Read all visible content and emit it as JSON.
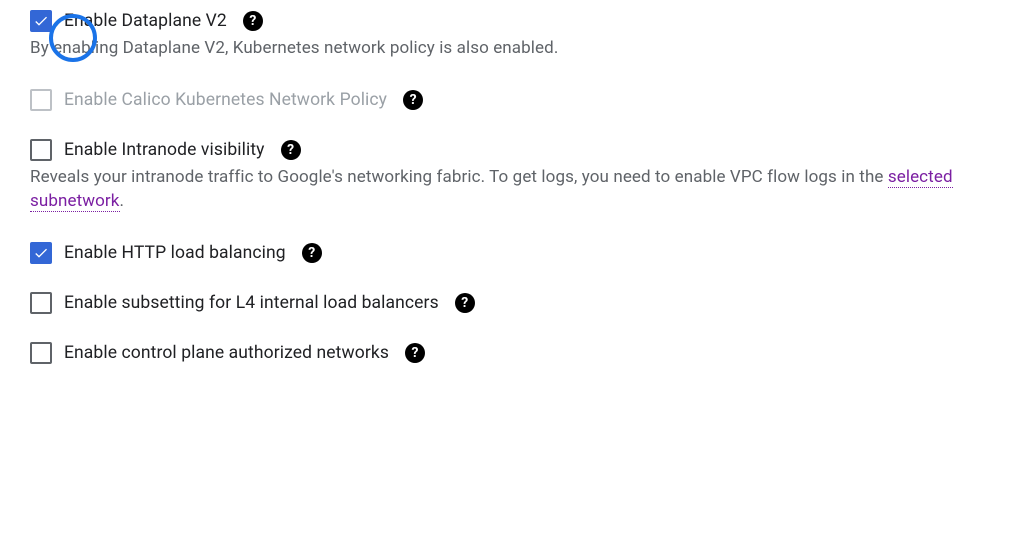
{
  "options": {
    "dataplane_v2": {
      "label": "Enable Dataplane V2",
      "description": "By enabling Dataplane V2, Kubernetes network policy is also enabled."
    },
    "calico": {
      "label": "Enable Calico Kubernetes Network Policy"
    },
    "intranode": {
      "label": "Enable Intranode visibility",
      "description_pre": "Reveals your intranode traffic to Google's networking fabric. To get logs, you need to enable VPC flow logs in the ",
      "link_text": "selected subnetwork",
      "description_post": "."
    },
    "http_lb": {
      "label": "Enable HTTP load balancing"
    },
    "subsetting": {
      "label": "Enable subsetting for L4 internal load balancers"
    },
    "control_plane": {
      "label": "Enable control plane authorized networks"
    }
  }
}
